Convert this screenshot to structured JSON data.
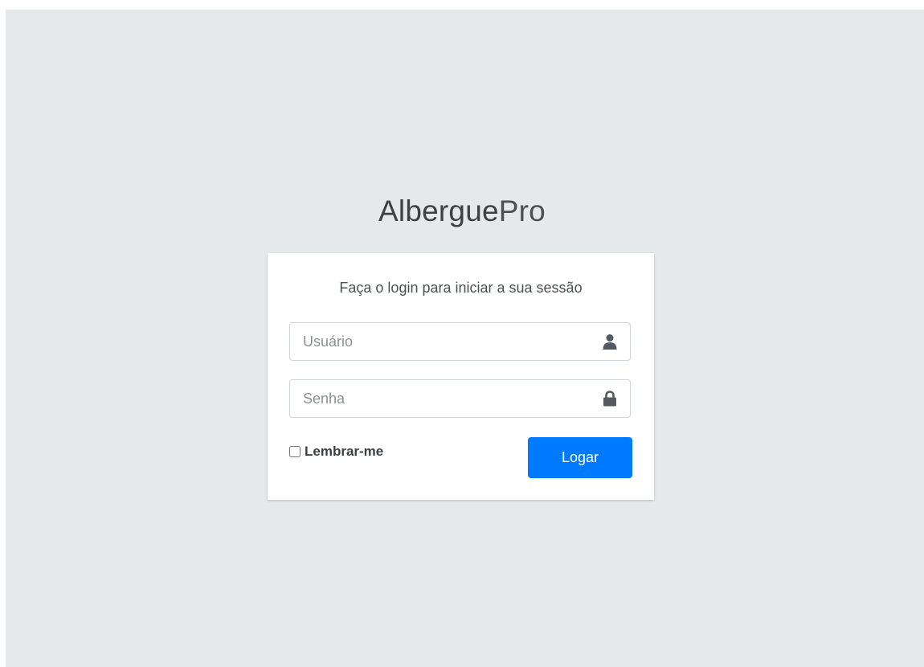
{
  "logo": {
    "part1": "Albergue",
    "part2": "Pro"
  },
  "login": {
    "message": "Faça o login para iniciar a sua sessão",
    "username": {
      "placeholder": "Usuário",
      "value": "",
      "icon": "user-icon"
    },
    "password": {
      "placeholder": "Senha",
      "value": "",
      "icon": "lock-icon"
    },
    "remember": {
      "label": "Lembrar-me",
      "checked": false
    },
    "submit_label": "Logar"
  },
  "colors": {
    "page_background": "#e5e9ea",
    "card_background": "#ffffff",
    "button_primary": "#007bff",
    "icon": "#555a60"
  }
}
